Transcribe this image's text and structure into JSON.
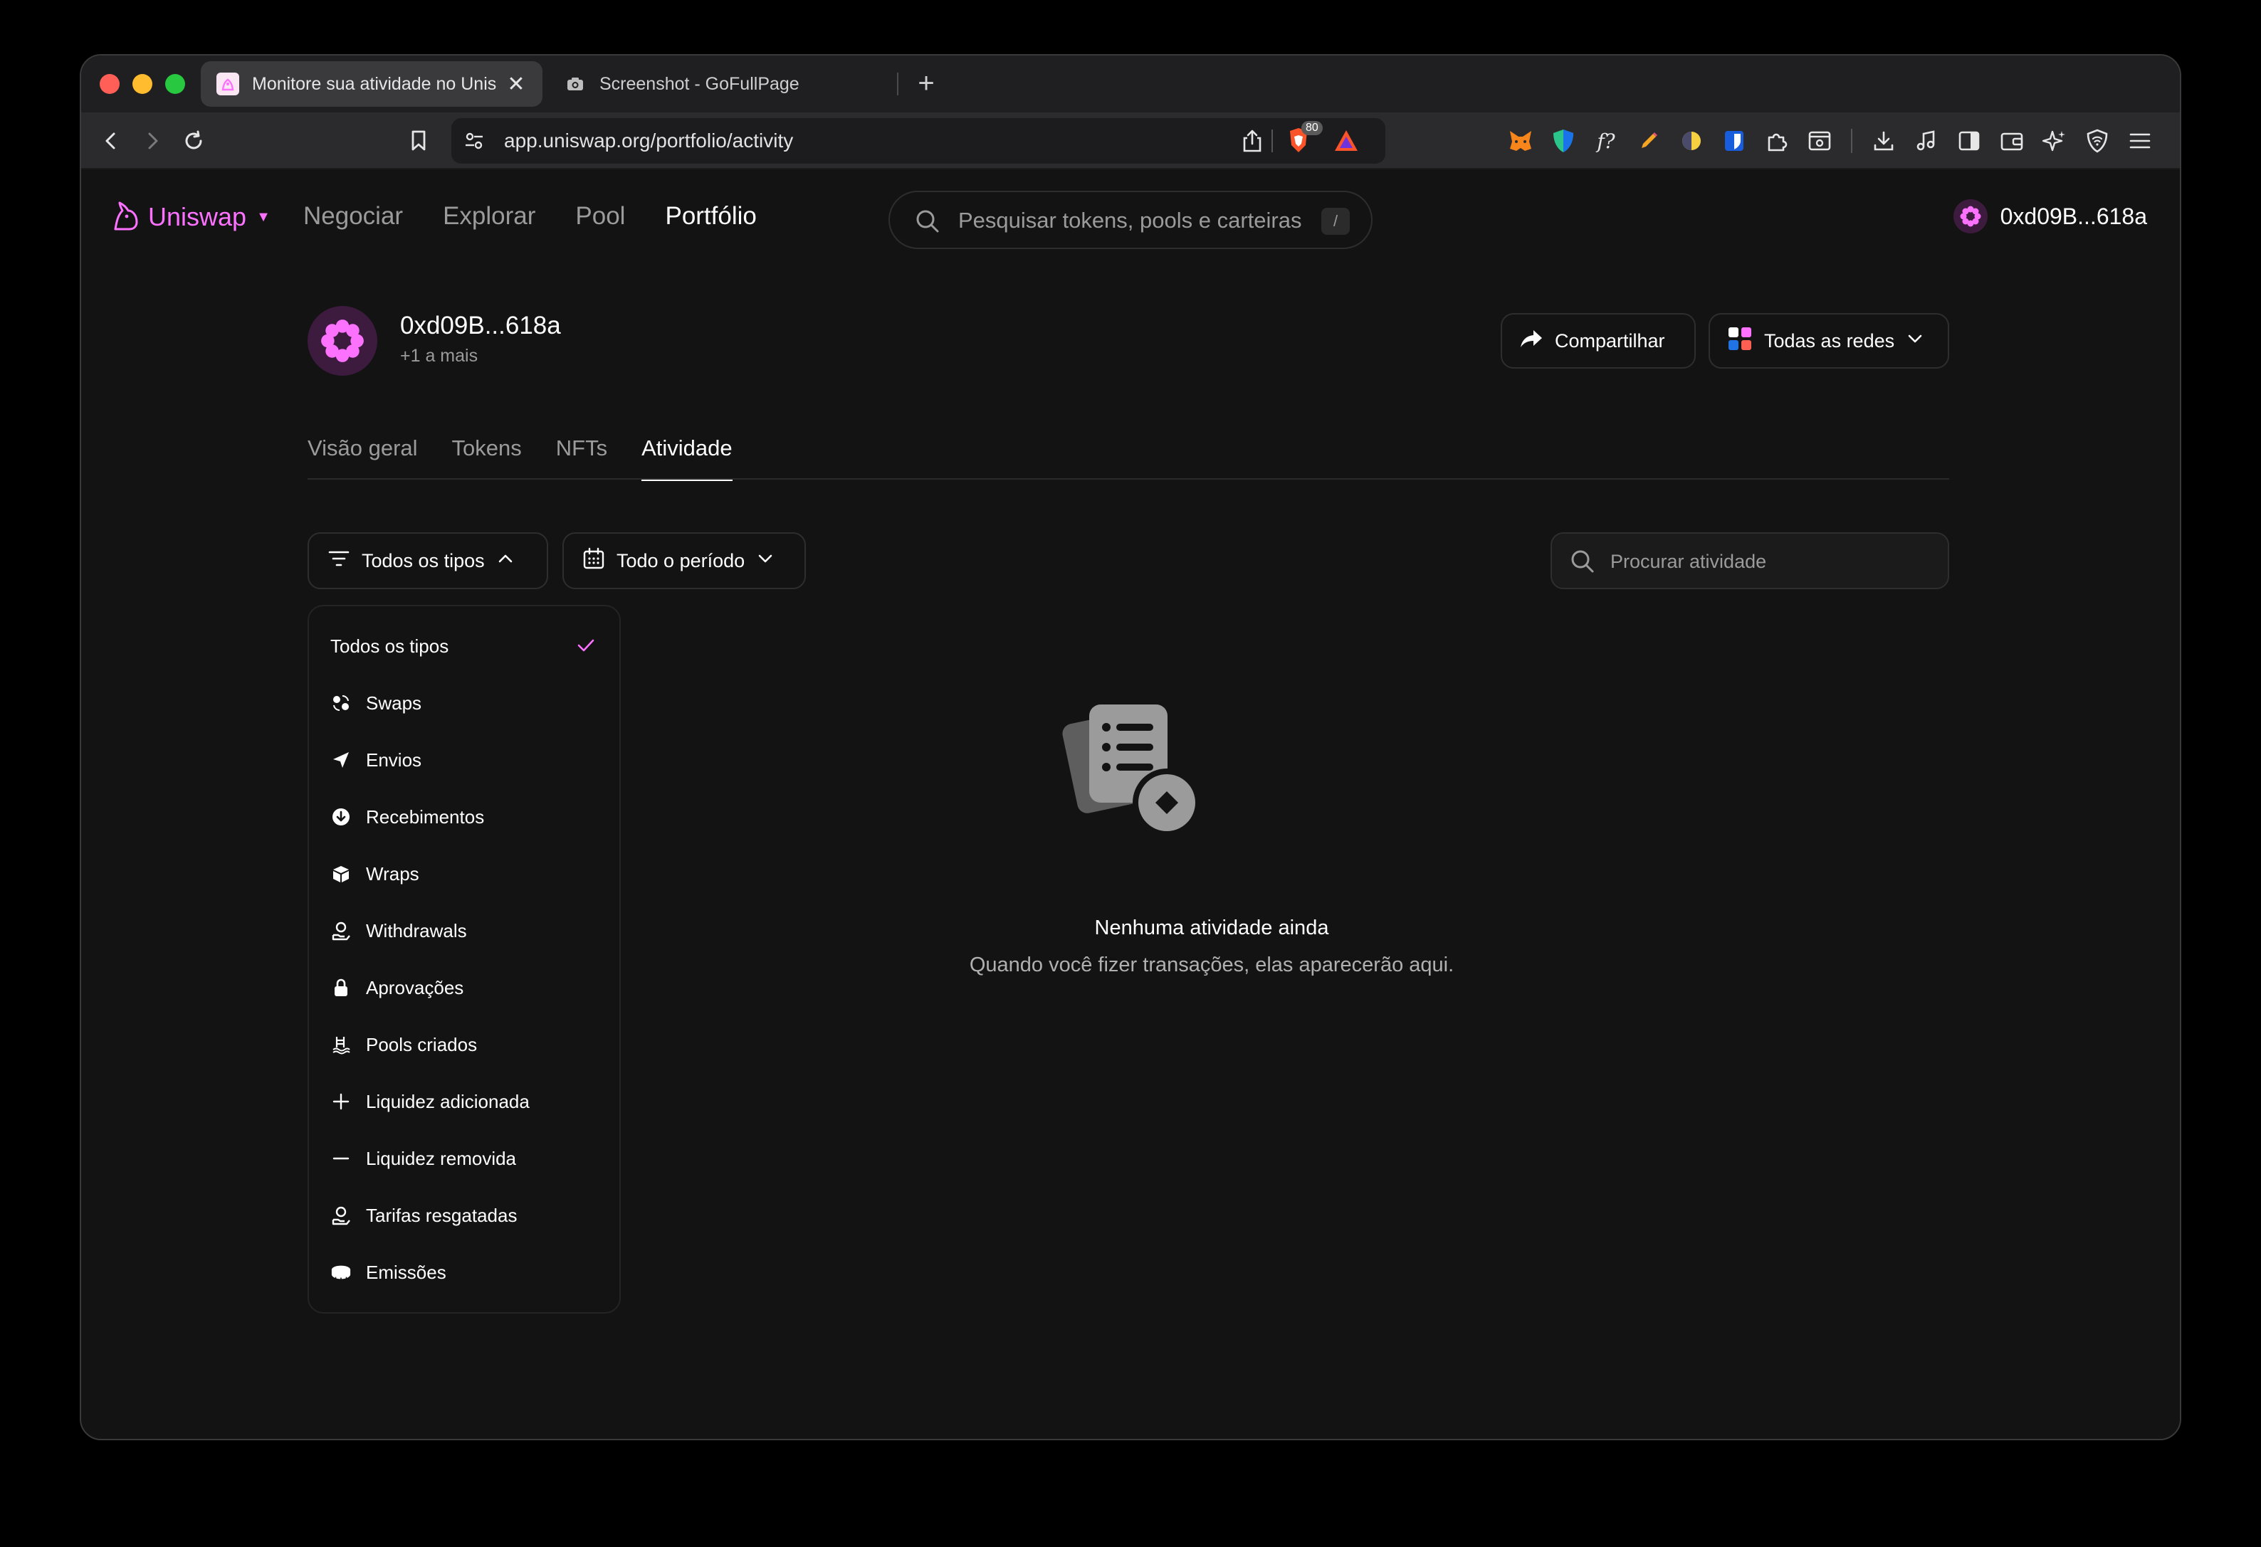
{
  "browser": {
    "tabs": [
      {
        "title": "Monitore sua atividade no Unis",
        "close": "✕"
      },
      {
        "title": "Screenshot - GoFullPage"
      }
    ],
    "new_tab": "+",
    "url": "app.uniswap.org/portfolio/activity",
    "brave_badge": "80"
  },
  "header": {
    "logo": "Uniswap",
    "nav": [
      "Negociar",
      "Explorar",
      "Pool",
      "Portfólio"
    ],
    "search_placeholder": "Pesquisar tokens, pools e carteiras",
    "search_shortcut": "/",
    "account": "0xd09B...618a"
  },
  "profile": {
    "name": "0xd09B...618a",
    "sub": "+1 a mais",
    "share_label": "Compartilhar",
    "network_label": "Todas as redes"
  },
  "tabs": [
    "Visão geral",
    "Tokens",
    "NFTs",
    "Atividade"
  ],
  "filters": {
    "types_label": "Todos os tipos",
    "period_label": "Todo o período",
    "search_placeholder": "Procurar atividade"
  },
  "dropdown": {
    "items": [
      {
        "label": "Todos os tipos",
        "icon": "none",
        "selected": true
      },
      {
        "label": "Swaps",
        "icon": "swap-icon"
      },
      {
        "label": "Envios",
        "icon": "send-icon"
      },
      {
        "label": "Recebimentos",
        "icon": "receive-icon"
      },
      {
        "label": "Wraps",
        "icon": "wrap-icon"
      },
      {
        "label": "Withdrawals",
        "icon": "withdraw-icon"
      },
      {
        "label": "Aprovações",
        "icon": "lock-icon"
      },
      {
        "label": "Pools criados",
        "icon": "pool-icon"
      },
      {
        "label": "Liquidez adicionada",
        "icon": "plus-icon"
      },
      {
        "label": "Liquidez removida",
        "icon": "minus-icon"
      },
      {
        "label": "Tarifas resgatadas",
        "icon": "fees-icon"
      },
      {
        "label": "Emissões",
        "icon": "coins-icon"
      }
    ]
  },
  "empty": {
    "title": "Nenhuma atividade ainda",
    "subtitle": "Quando você fizer transações, elas aparecerão aqui."
  },
  "help": "?",
  "colors": {
    "accent": "#fc72ff",
    "bg": "#131313",
    "muted": "#9b9b9b"
  }
}
